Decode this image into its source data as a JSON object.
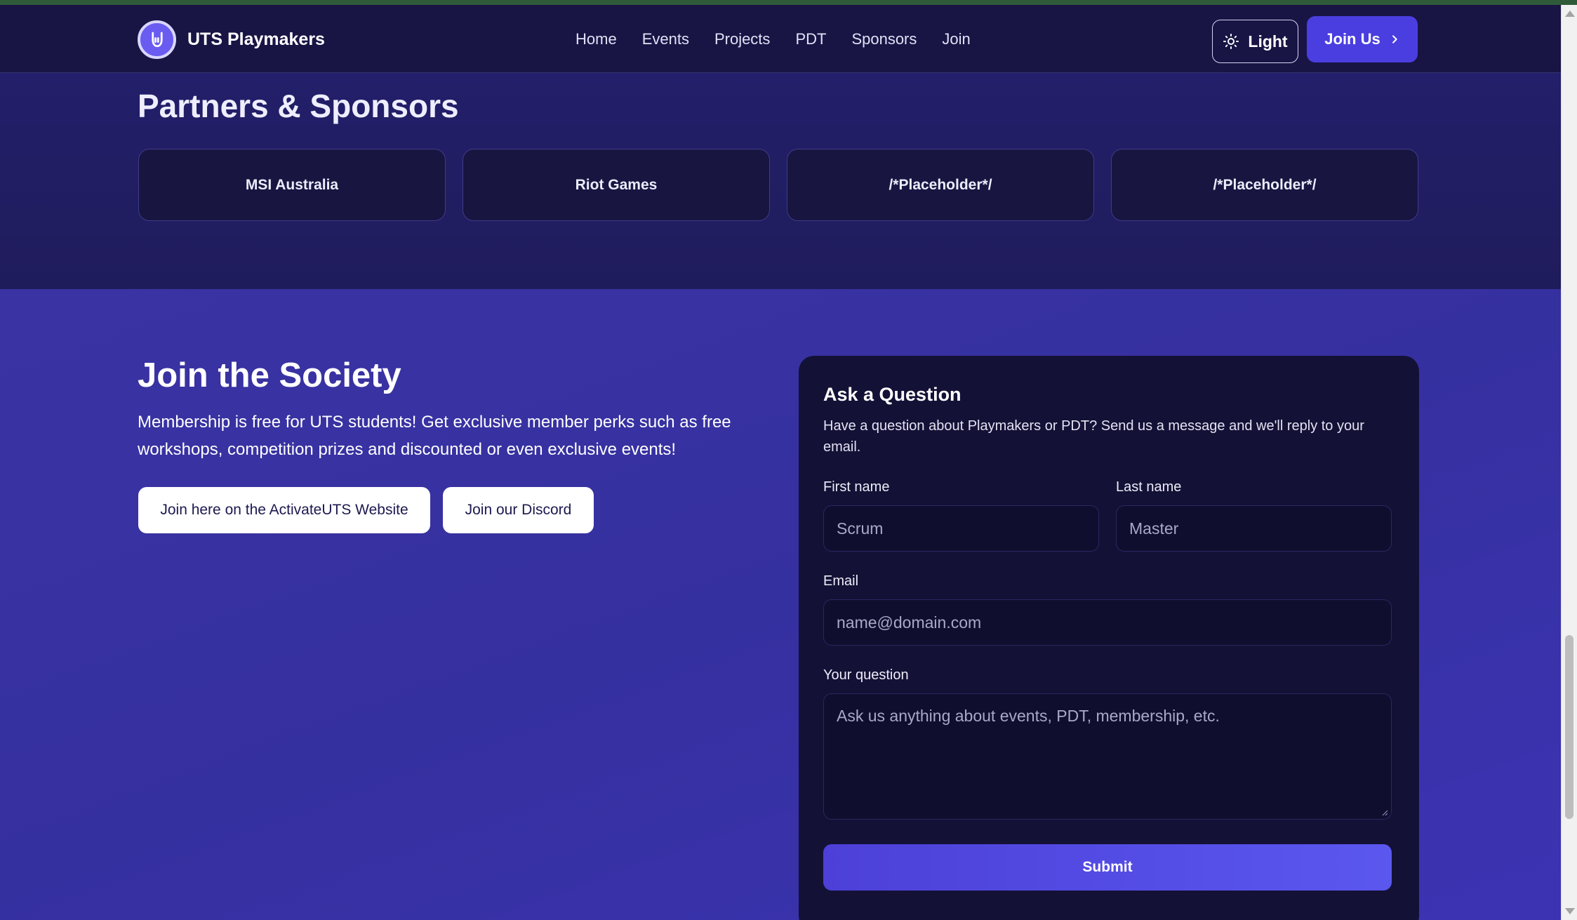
{
  "header": {
    "brand_name": "UTS Playmakers",
    "logo_icon": "rock-hand-icon",
    "nav": [
      "Home",
      "Events",
      "Projects",
      "PDT",
      "Sponsors",
      "Join"
    ],
    "theme_toggle_label": "Light",
    "join_us_label": "Join Us"
  },
  "partners": {
    "title": "Partners & Sponsors",
    "sponsors": [
      "MSI Australia",
      "Riot Games",
      "/*Placeholder*/",
      "/*Placeholder*/"
    ]
  },
  "join": {
    "title": "Join the Society",
    "description": "Membership is free for UTS students! Get exclusive member perks such as free workshops, competition prizes and discounted or even exclusive events!",
    "activate_button": "Join here on the ActivateUTS Website",
    "discord_button": "Join our Discord"
  },
  "form": {
    "title": "Ask a Question",
    "description": "Have a question about Playmakers or PDT? Send us a message and we'll reply to your email.",
    "first_name_label": "First name",
    "first_name_placeholder": "Scrum",
    "last_name_label": "Last name",
    "last_name_placeholder": "Master",
    "email_label": "Email",
    "email_placeholder": "name@domain.com",
    "question_label": "Your question",
    "question_placeholder": "Ask us anything about events, PDT, membership, etc.",
    "submit_label": "Submit"
  },
  "colors": {
    "accent": "#4a3ee0",
    "header_bg": "#181545",
    "section_bg": "#3a33a3"
  }
}
